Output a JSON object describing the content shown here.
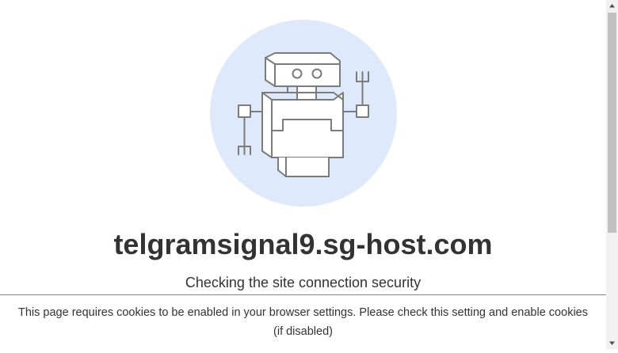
{
  "page": {
    "domain": "telgramsignal9.sg-host.com",
    "status": "Checking the site connection security"
  },
  "cookie_notice": {
    "text": "This page requires cookies to be enabled in your browser settings. Please check this setting and enable cookies (if disabled)"
  },
  "illustration": {
    "icon": "robot-icon",
    "circle_color": "#deeafb",
    "stroke_color": "#7b7b7b"
  }
}
